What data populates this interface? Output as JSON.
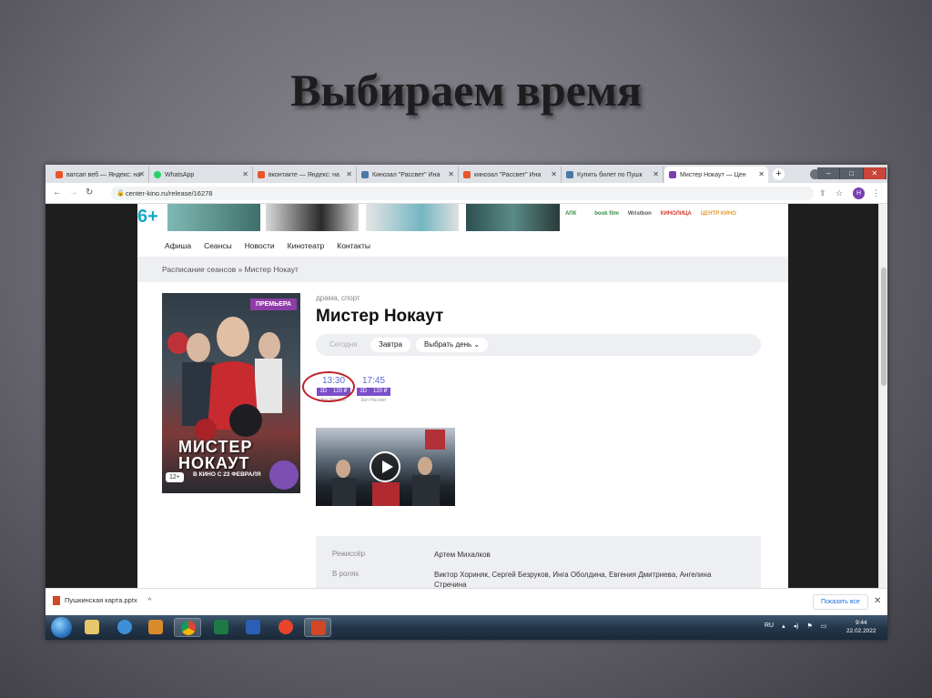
{
  "slide": {
    "title": "Выбираем время"
  },
  "browser": {
    "tabs": [
      {
        "label": "ватсап веб — Яндекс: на",
        "color": "#e8552b"
      },
      {
        "label": "WhatsApp",
        "color": "#25d366"
      },
      {
        "label": "вконтакте — Яндекс: на",
        "color": "#e8552b"
      },
      {
        "label": "Кинозал \"Рассвет\" Ина",
        "color": "#4a76a8"
      },
      {
        "label": "кинозал \"Рассвет\" Ина",
        "color": "#e8552b"
      },
      {
        "label": "Купить билет по Пушк",
        "color": "#4a76a8"
      },
      {
        "label": "Мистер Нокаут — Цен",
        "color": "#7b3fb0"
      }
    ],
    "new_tab": "+",
    "url": "center-kino.ru/release/16278",
    "avatar_letter": "Н"
  },
  "site": {
    "age_badge": "6+",
    "sponsors": [
      "АПК",
      "",
      "book film",
      "Wristbon",
      "КИНОЛИЦА",
      "ЦЕНТР КИНО"
    ],
    "nav": [
      "Афиша",
      "Сеансы",
      "Новости",
      "Кинотеатр",
      "Контакты"
    ],
    "breadcrumb": "Расписание сеансов  »  Мистер Нокаут",
    "poster": {
      "premiere": "ПРЕМЬЕРА",
      "title": "МИСТЕР НОКАУТ",
      "date_line": "В КИНО С 23 ФЕВРАЛЯ",
      "age": "12+"
    },
    "genre": "драма, спорт",
    "film_title": "Мистер Нокаут",
    "days": {
      "today": "Сегодня",
      "tomorrow": "Завтра",
      "choose": "Выбрать день ⌄"
    },
    "sessions": [
      {
        "time": "13:30",
        "format": "2D",
        "price": "120 ₽",
        "hall": "Зал Рассвет"
      },
      {
        "time": "17:45",
        "format": "2D",
        "price": "120 ₽",
        "hall": "Зал Рассвет"
      }
    ],
    "info": {
      "director_label": "Режиссёр",
      "director": "Артем Михалков",
      "cast_label": "В ролях",
      "cast": "Виктор Хориняк, Сергей Безруков, Инга Оболдина, Евгения Дмитриева, Ангелина Стречина"
    }
  },
  "downloads": {
    "file": "Пушкинская карта.pptx",
    "show_all": "Показать все",
    "close": "✕"
  },
  "taskbar": {
    "lang": "RU",
    "time": "9:44",
    "date": "22.02.2022"
  }
}
